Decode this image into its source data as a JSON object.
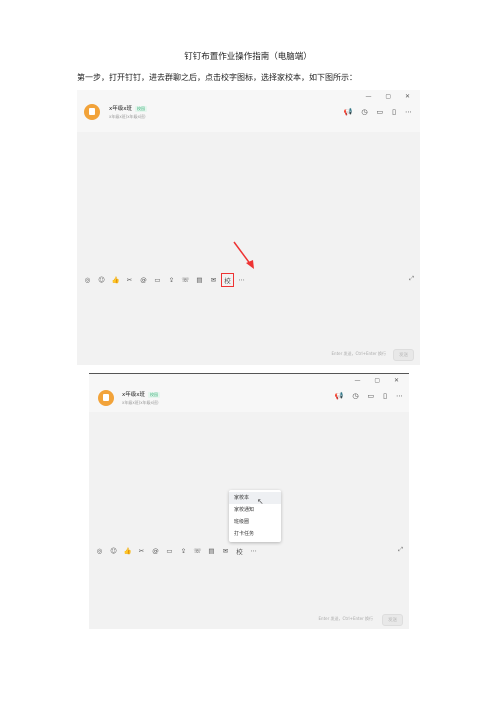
{
  "doc": {
    "title": "钉钉布置作业操作指南（电脑端）",
    "step1": "第一步，打开钉钉，进去群聊之后，点击校字图标，选择家校本，如下图所示："
  },
  "chat": {
    "group_name": "x年级x班",
    "tag": "校园",
    "members": "x年级x班(x年级x班)",
    "window_controls": "—  ▢  ✕",
    "header_icons": [
      "megaphone-icon",
      "clock-icon",
      "folder-icon",
      "file-icon",
      "more-icon"
    ],
    "toolbar_icons": [
      "sticker",
      "emoji",
      "thumb",
      "scissors",
      "at",
      "folder",
      "upload",
      "phone",
      "clipboard",
      "mail",
      "school",
      "more"
    ],
    "input_hint": "Enter 发送，Ctrl+Enter 换行",
    "send_label": "发送"
  },
  "menu": {
    "items": [
      "家校本",
      "家校通知",
      "班级圈",
      "打卡任务"
    ]
  },
  "colors": {
    "highlight": "#e33333",
    "avatar": "#f2a33a",
    "tag": "#3bb27a"
  }
}
